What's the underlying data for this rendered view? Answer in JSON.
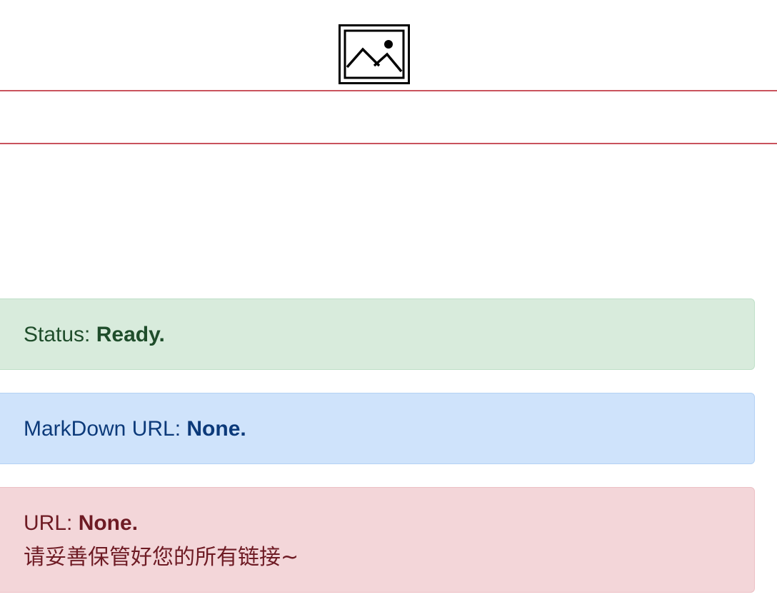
{
  "header": {
    "image_icon": "broken-image-icon"
  },
  "status": {
    "label": "Status: ",
    "value": "Ready."
  },
  "markdown_url": {
    "label": "MarkDown URL: ",
    "value": "None."
  },
  "url": {
    "label": "URL: ",
    "value": "None.",
    "note": "请妥善保管好您的所有链接~"
  },
  "colors": {
    "divider": "#c9535d",
    "success_bg": "#d8ebdc",
    "info_bg": "#cfe3fb",
    "danger_bg": "#f3d6d9"
  }
}
